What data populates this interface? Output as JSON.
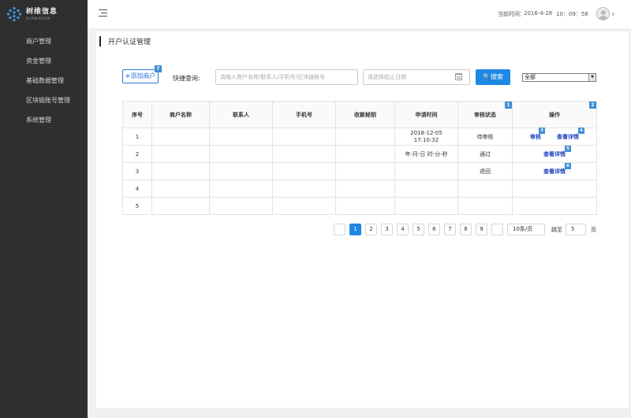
{
  "brand": {
    "name": "树维信息",
    "sub": "SUPWISDOM",
    "logo_color": "#3d9be9"
  },
  "sidebar": {
    "items": [
      {
        "label": "商户管理"
      },
      {
        "label": "资金管理"
      },
      {
        "label": "基础数据管理"
      },
      {
        "label": "区块链账号管理"
      },
      {
        "label": "系统管理"
      }
    ]
  },
  "header": {
    "time_label": "当前时间：",
    "date": "2016-4-28",
    "clock": "10：09：58",
    "menu_icon": "hamburger-icon",
    "avatar_icon": "user-avatar-icon"
  },
  "page": {
    "title": "开户认证管理"
  },
  "toolbar": {
    "add_label": "添加商户",
    "add_badge": "7",
    "quick_label": "快捷查询:",
    "search_placeholder": "请输入商户名称/联系人/手机号/区块链账号",
    "date_placeholder": "请选择起止日期",
    "search_label": "搜索",
    "filter_value": "全部"
  },
  "table": {
    "headers": [
      "序号",
      "商户名称",
      "联系人",
      "手机号",
      "收款秘钥",
      "申请时间",
      "审核状态",
      "操作"
    ],
    "header_badges": {
      "status": "1",
      "action": "2"
    },
    "rows": [
      {
        "no": "1",
        "time_line1": "2018-12-05",
        "time_line2": "17:10:32",
        "status": "待审核",
        "op1": "审核",
        "op1_badge": "3",
        "op2": "查看详情",
        "op2_badge": "4"
      },
      {
        "no": "2",
        "time_line1": "年-月-日  时-分-秒",
        "time_line2": "",
        "status": "通过",
        "op1": "查看详情",
        "op1_badge": "5"
      },
      {
        "no": "3",
        "status": "退回",
        "op1": "查看详情",
        "op1_badge": "6"
      },
      {
        "no": "4"
      },
      {
        "no": "5"
      }
    ]
  },
  "pagination": {
    "pages": [
      "1",
      "2",
      "3",
      "4",
      "5",
      "6",
      "7",
      "8",
      "9"
    ],
    "current": "1",
    "page_size": "10条/页",
    "jump_label": "跳至",
    "jump_value": "5",
    "unit": "页"
  },
  "colors": {
    "accent": "#1e88e5",
    "sidebar_bg": "#2f2f2f",
    "badge": "#3c8fd6",
    "link": "#1a3fb8"
  }
}
